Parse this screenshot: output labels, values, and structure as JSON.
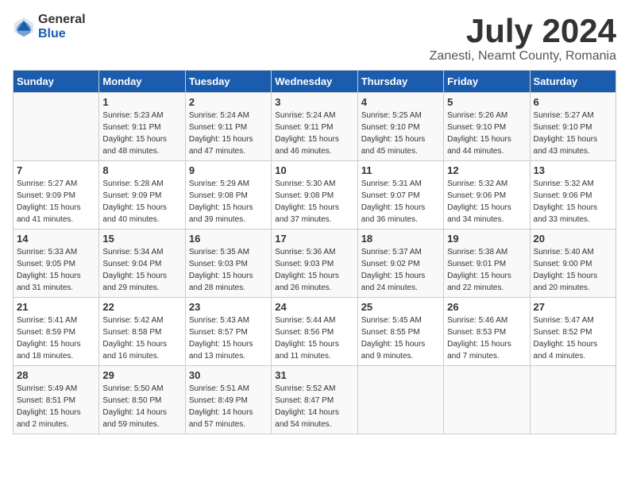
{
  "logo": {
    "general": "General",
    "blue": "Blue"
  },
  "title": "July 2024",
  "subtitle": "Zanesti, Neamt County, Romania",
  "headers": [
    "Sunday",
    "Monday",
    "Tuesday",
    "Wednesday",
    "Thursday",
    "Friday",
    "Saturday"
  ],
  "weeks": [
    [
      {
        "day": "",
        "detail": ""
      },
      {
        "day": "1",
        "detail": "Sunrise: 5:23 AM\nSunset: 9:11 PM\nDaylight: 15 hours\nand 48 minutes."
      },
      {
        "day": "2",
        "detail": "Sunrise: 5:24 AM\nSunset: 9:11 PM\nDaylight: 15 hours\nand 47 minutes."
      },
      {
        "day": "3",
        "detail": "Sunrise: 5:24 AM\nSunset: 9:11 PM\nDaylight: 15 hours\nand 46 minutes."
      },
      {
        "day": "4",
        "detail": "Sunrise: 5:25 AM\nSunset: 9:10 PM\nDaylight: 15 hours\nand 45 minutes."
      },
      {
        "day": "5",
        "detail": "Sunrise: 5:26 AM\nSunset: 9:10 PM\nDaylight: 15 hours\nand 44 minutes."
      },
      {
        "day": "6",
        "detail": "Sunrise: 5:27 AM\nSunset: 9:10 PM\nDaylight: 15 hours\nand 43 minutes."
      }
    ],
    [
      {
        "day": "7",
        "detail": "Sunrise: 5:27 AM\nSunset: 9:09 PM\nDaylight: 15 hours\nand 41 minutes."
      },
      {
        "day": "8",
        "detail": "Sunrise: 5:28 AM\nSunset: 9:09 PM\nDaylight: 15 hours\nand 40 minutes."
      },
      {
        "day": "9",
        "detail": "Sunrise: 5:29 AM\nSunset: 9:08 PM\nDaylight: 15 hours\nand 39 minutes."
      },
      {
        "day": "10",
        "detail": "Sunrise: 5:30 AM\nSunset: 9:08 PM\nDaylight: 15 hours\nand 37 minutes."
      },
      {
        "day": "11",
        "detail": "Sunrise: 5:31 AM\nSunset: 9:07 PM\nDaylight: 15 hours\nand 36 minutes."
      },
      {
        "day": "12",
        "detail": "Sunrise: 5:32 AM\nSunset: 9:06 PM\nDaylight: 15 hours\nand 34 minutes."
      },
      {
        "day": "13",
        "detail": "Sunrise: 5:32 AM\nSunset: 9:06 PM\nDaylight: 15 hours\nand 33 minutes."
      }
    ],
    [
      {
        "day": "14",
        "detail": "Sunrise: 5:33 AM\nSunset: 9:05 PM\nDaylight: 15 hours\nand 31 minutes."
      },
      {
        "day": "15",
        "detail": "Sunrise: 5:34 AM\nSunset: 9:04 PM\nDaylight: 15 hours\nand 29 minutes."
      },
      {
        "day": "16",
        "detail": "Sunrise: 5:35 AM\nSunset: 9:03 PM\nDaylight: 15 hours\nand 28 minutes."
      },
      {
        "day": "17",
        "detail": "Sunrise: 5:36 AM\nSunset: 9:03 PM\nDaylight: 15 hours\nand 26 minutes."
      },
      {
        "day": "18",
        "detail": "Sunrise: 5:37 AM\nSunset: 9:02 PM\nDaylight: 15 hours\nand 24 minutes."
      },
      {
        "day": "19",
        "detail": "Sunrise: 5:38 AM\nSunset: 9:01 PM\nDaylight: 15 hours\nand 22 minutes."
      },
      {
        "day": "20",
        "detail": "Sunrise: 5:40 AM\nSunset: 9:00 PM\nDaylight: 15 hours\nand 20 minutes."
      }
    ],
    [
      {
        "day": "21",
        "detail": "Sunrise: 5:41 AM\nSunset: 8:59 PM\nDaylight: 15 hours\nand 18 minutes."
      },
      {
        "day": "22",
        "detail": "Sunrise: 5:42 AM\nSunset: 8:58 PM\nDaylight: 15 hours\nand 16 minutes."
      },
      {
        "day": "23",
        "detail": "Sunrise: 5:43 AM\nSunset: 8:57 PM\nDaylight: 15 hours\nand 13 minutes."
      },
      {
        "day": "24",
        "detail": "Sunrise: 5:44 AM\nSunset: 8:56 PM\nDaylight: 15 hours\nand 11 minutes."
      },
      {
        "day": "25",
        "detail": "Sunrise: 5:45 AM\nSunset: 8:55 PM\nDaylight: 15 hours\nand 9 minutes."
      },
      {
        "day": "26",
        "detail": "Sunrise: 5:46 AM\nSunset: 8:53 PM\nDaylight: 15 hours\nand 7 minutes."
      },
      {
        "day": "27",
        "detail": "Sunrise: 5:47 AM\nSunset: 8:52 PM\nDaylight: 15 hours\nand 4 minutes."
      }
    ],
    [
      {
        "day": "28",
        "detail": "Sunrise: 5:49 AM\nSunset: 8:51 PM\nDaylight: 15 hours\nand 2 minutes."
      },
      {
        "day": "29",
        "detail": "Sunrise: 5:50 AM\nSunset: 8:50 PM\nDaylight: 14 hours\nand 59 minutes."
      },
      {
        "day": "30",
        "detail": "Sunrise: 5:51 AM\nSunset: 8:49 PM\nDaylight: 14 hours\nand 57 minutes."
      },
      {
        "day": "31",
        "detail": "Sunrise: 5:52 AM\nSunset: 8:47 PM\nDaylight: 14 hours\nand 54 minutes."
      },
      {
        "day": "",
        "detail": ""
      },
      {
        "day": "",
        "detail": ""
      },
      {
        "day": "",
        "detail": ""
      }
    ]
  ]
}
